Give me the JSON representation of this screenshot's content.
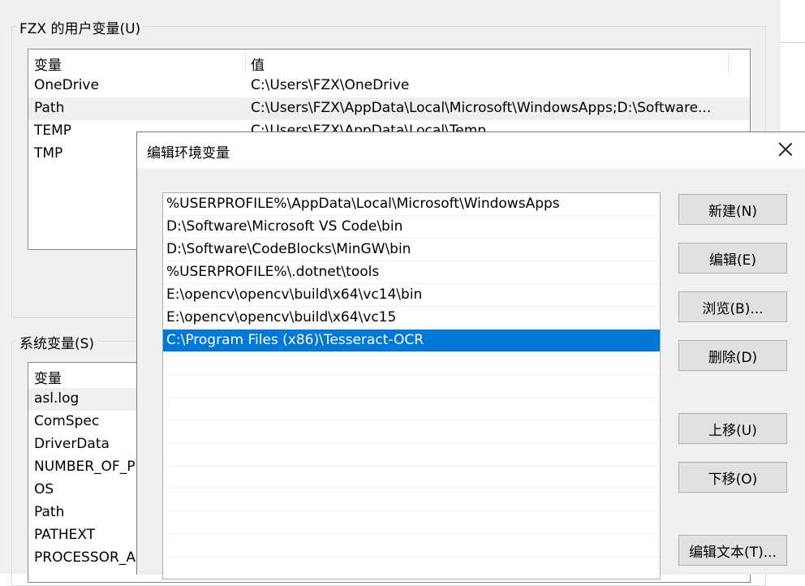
{
  "user_vars": {
    "group_title": "FZX 的用户变量(U)",
    "columns": [
      "变量",
      "值"
    ],
    "rows": [
      {
        "name": "OneDrive",
        "value": "C:\\Users\\FZX\\OneDrive"
      },
      {
        "name": "Path",
        "value": "C:\\Users\\FZX\\AppData\\Local\\Microsoft\\WindowsApps;D:\\Software..."
      },
      {
        "name": "TEMP",
        "value": "C:\\Users\\FZX\\AppData\\Local\\Temp"
      },
      {
        "name": "TMP",
        "value": ""
      }
    ]
  },
  "system_vars": {
    "group_title": "系统变量(S)",
    "columns": [
      "变量"
    ],
    "rows": [
      "asl.log",
      "ComSpec",
      "DriverData",
      "NUMBER_OF_P",
      "OS",
      "Path",
      "PATHEXT",
      "PROCESSOR_A"
    ]
  },
  "edit_dialog": {
    "title": "编辑环境变量",
    "paths": [
      "%USERPROFILE%\\AppData\\Local\\Microsoft\\WindowsApps",
      "D:\\Software\\Microsoft VS Code\\bin",
      "D:\\Software\\CodeBlocks\\MinGW\\bin",
      "%USERPROFILE%\\.dotnet\\tools",
      "E:\\opencv\\opencv\\build\\x64\\vc14\\bin",
      "E:\\opencv\\opencv\\build\\x64\\vc15",
      "C:\\Program Files (x86)\\Tesseract-OCR"
    ],
    "selected_index": 6,
    "buttons": {
      "new": "新建(N)",
      "edit": "编辑(E)",
      "browse": "浏览(B)...",
      "delete": "删除(D)",
      "move_up": "上移(U)",
      "move_down": "下移(O)",
      "edit_text": "编辑文本(T)..."
    }
  },
  "colors": {
    "selection": "#0078d7",
    "dialog_bg": "#f0f0f0",
    "button_bg": "#e1e1e1"
  }
}
